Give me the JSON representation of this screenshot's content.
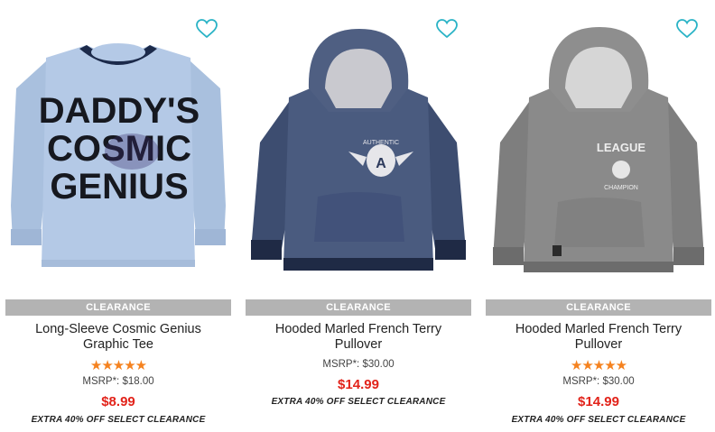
{
  "products": [
    {
      "badge": "CLEARANCE",
      "title": "Long-Sleeve Cosmic Genius Graphic Tee",
      "has_rating": true,
      "stars": "★★★★★",
      "msrp": "MSRP*: $18.00",
      "price": "$8.99",
      "promo": "EXTRA 40% OFF SELECT CLEARANCE",
      "print_text": [
        "DADDY'S",
        "COSMIC",
        "GENIUS"
      ],
      "icon": "heart-outline-icon"
    },
    {
      "badge": "CLEARANCE",
      "title": "Hooded Marled French Terry Pullover",
      "has_rating": false,
      "msrp": "MSRP*: $30.00",
      "price": "$14.99",
      "promo": "EXTRA 40% OFF SELECT CLEARANCE",
      "print_text": [
        "AUTHENTIC",
        "A"
      ],
      "icon": "heart-outline-icon"
    },
    {
      "badge": "CLEARANCE",
      "title": "Hooded Marled French Terry Pullover",
      "has_rating": true,
      "stars": "★★★★★",
      "msrp": "MSRP*: $30.00",
      "price": "$14.99",
      "promo": "EXTRA 40% OFF SELECT CLEARANCE",
      "print_text": [
        "LEAGUE",
        "CHAMPION"
      ],
      "icon": "heart-outline-icon"
    }
  ],
  "colors": {
    "heart": "#2ab3c6",
    "badge_bg": "#b3b3b3",
    "stars": "#f5821f",
    "price": "#e2231a"
  }
}
